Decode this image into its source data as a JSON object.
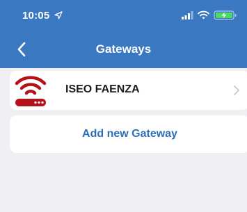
{
  "status_bar": {
    "time": "10:05",
    "icons": [
      "location-arrow-icon",
      "cellular-signal-icon",
      "wifi-icon",
      "battery-charging-icon"
    ]
  },
  "nav": {
    "title": "Gateways",
    "back_icon": "chevron-left-icon"
  },
  "gateways": [
    {
      "name": "ISEO FAENZA",
      "icon": "router-wifi-icon",
      "disclosure_icon": "chevron-right-icon"
    }
  ],
  "add_gateway_label": "Add new Gateway",
  "colors": {
    "header": "#3a78c2",
    "background": "#efeff4",
    "accent_text": "#2f6fb9",
    "router_icon": "#b3121b",
    "battery_charging": "#4cd964"
  }
}
